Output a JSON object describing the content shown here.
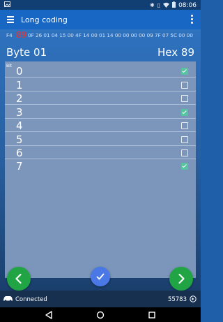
{
  "status_bar": {
    "time": "08:06",
    "icons": [
      "image-icon",
      "bluetooth-icon",
      "vibrate-icon",
      "wifi-icon",
      "battery-icon"
    ]
  },
  "app_bar": {
    "title": "Long coding"
  },
  "hex_row": {
    "first": "F4",
    "highlight": "89",
    "rest": "0F 26 01 04 15 00 4F 14 00 01 14 00 00 00 00 09 7F 07 5C 00 00"
  },
  "byte_header": {
    "byte_label": "Byte 01",
    "hex_label": "Hex 89"
  },
  "bits": {
    "header": "Bit",
    "rows": [
      {
        "label": "0",
        "checked": true
      },
      {
        "label": "1",
        "checked": false
      },
      {
        "label": "2",
        "checked": false
      },
      {
        "label": "3",
        "checked": true
      },
      {
        "label": "4",
        "checked": false
      },
      {
        "label": "5",
        "checked": false
      },
      {
        "label": "6",
        "checked": false
      },
      {
        "label": "7",
        "checked": true
      }
    ]
  },
  "footer": {
    "status": "Connected",
    "counter": "55783"
  },
  "colors": {
    "accent_green": "#21a444",
    "ok_blue": "#4a78e6",
    "checkbox_green": "#58c3a1",
    "highlight_red": "#e03a3a"
  }
}
